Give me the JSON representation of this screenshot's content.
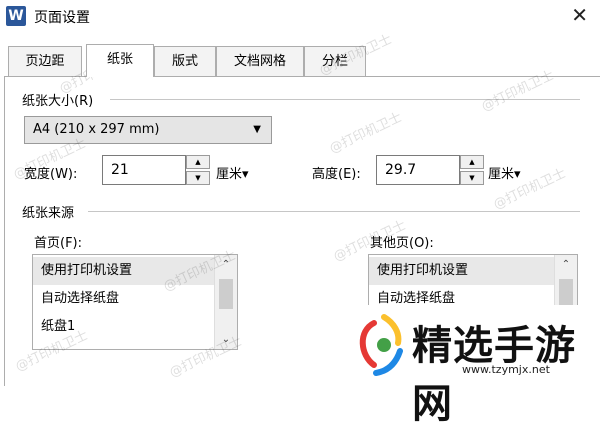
{
  "window": {
    "app_icon_letter": "W",
    "title": "页面设置",
    "close_glyph": "✕"
  },
  "tabs": [
    {
      "label": "页边距"
    },
    {
      "label": "纸张"
    },
    {
      "label": "版式"
    },
    {
      "label": "文档网格"
    },
    {
      "label": "分栏"
    }
  ],
  "active_tab": "纸张",
  "paper_size": {
    "section_label": "纸张大小(R)",
    "selected": "A4 (210 x 297 mm)",
    "width_label": "宽度(W):",
    "width_value": "21",
    "width_unit": "厘米▾",
    "height_label": "高度(E):",
    "height_value": "29.7",
    "height_unit": "厘米▾"
  },
  "paper_source": {
    "section_label": "纸张来源",
    "first_page_label": "首页(F):",
    "other_pages_label": "其他页(O):",
    "first_page_options": [
      "使用打印机设置",
      "自动选择纸盘",
      "纸盘1"
    ],
    "other_pages_options": [
      "使用打印机设置",
      "自动选择纸盘"
    ]
  },
  "watermark_text": "@打印机卫士",
  "brand": {
    "name": "精选手游网",
    "url": "www.tzymjx.net",
    "colors": [
      "#e53935",
      "#fbc02d",
      "#1e88e5",
      "#43a047"
    ]
  }
}
